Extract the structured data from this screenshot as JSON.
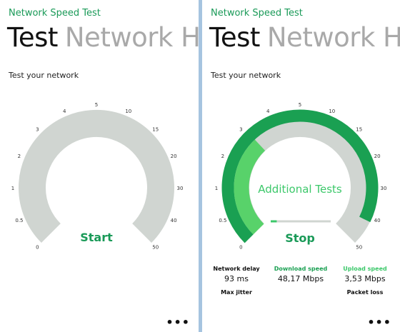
{
  "colors": {
    "accent": "#1a9a58",
    "gauge_track": "#d0d5d1",
    "gauge_outer": "#1aa052",
    "gauge_inner": "#58d26a",
    "label_green": "#3cc86a"
  },
  "left": {
    "app_title": "Network Speed Test",
    "pivot_active": "Test",
    "pivot_next": "Network H",
    "subtitle": "Test your network",
    "gauge": {
      "ticks": [
        "0",
        "0.5",
        "1",
        "2",
        "3",
        "4",
        "5",
        "10",
        "15",
        "20",
        "30",
        "40",
        "50"
      ],
      "button_label": "Start"
    },
    "more_label": "•••"
  },
  "right": {
    "app_title": "Network Speed Test",
    "pivot_active": "Test",
    "pivot_next": "Network H",
    "subtitle": "Test your network",
    "gauge": {
      "ticks": [
        "0",
        "0.5",
        "1",
        "2",
        "3",
        "4",
        "5",
        "10",
        "15",
        "20",
        "30",
        "40",
        "50"
      ],
      "status_label": "Additional Tests",
      "button_label": "Stop",
      "outer_progress": 0.93,
      "inner_progress": 0.34,
      "test_progress": 0.1
    },
    "stats": {
      "delay_label": "Network delay",
      "delay_value": "93 ms",
      "jitter_label": "Max jitter",
      "download_label": "Download speed",
      "download_value": "48,17 Mbps",
      "upload_label": "Upload speed",
      "upload_value": "3,53 Mbps",
      "loss_label": "Packet loss"
    },
    "more_label": "•••"
  }
}
